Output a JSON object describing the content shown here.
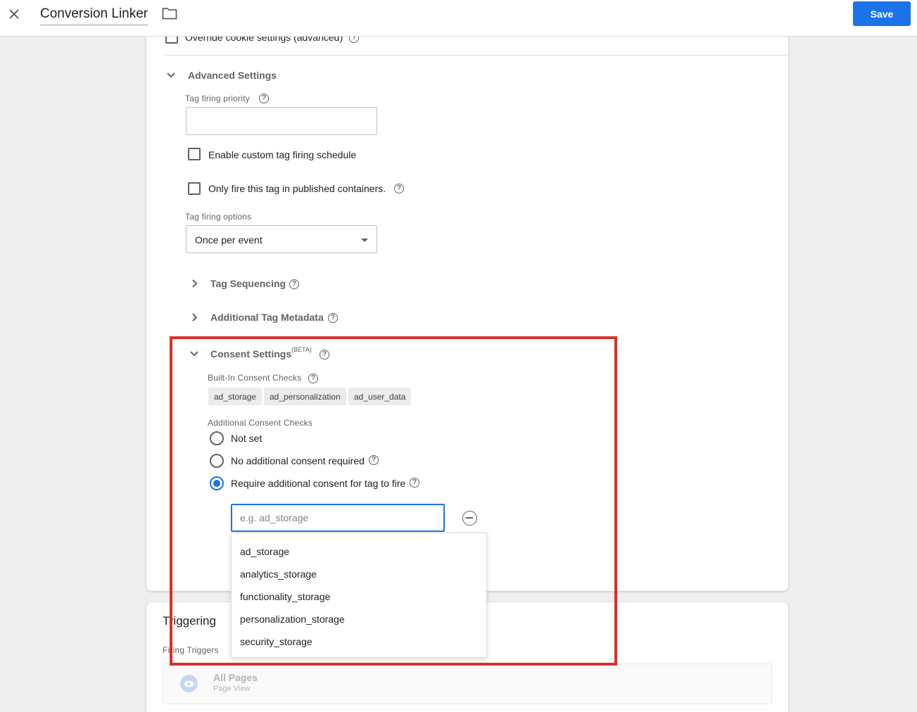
{
  "header": {
    "title": "Conversion Linker",
    "save_label": "Save"
  },
  "cookie": {
    "override_label": "Override cookie settings (advanced)"
  },
  "advanced": {
    "title": "Advanced Settings",
    "priority_label": "Tag firing priority",
    "priority_value": "",
    "custom_schedule_label": "Enable custom tag firing schedule",
    "published_only_label": "Only fire this tag in published containers.",
    "firing_options_label": "Tag firing options",
    "firing_options_value": "Once per event",
    "tag_sequencing": "Tag Sequencing",
    "additional_metadata": "Additional Tag Metadata"
  },
  "consent": {
    "title": "Consent Settings",
    "beta": "(BETA)",
    "builtin_label": "Built-In Consent Checks",
    "builtin_chips": [
      "ad_storage",
      "ad_personalization",
      "ad_user_data"
    ],
    "additional_label": "Additional Consent Checks",
    "options": [
      "Not set",
      "No additional consent required",
      "Require additional consent for tag to fire"
    ],
    "selected_option": "Require additional consent for tag to fire",
    "input_value": "",
    "input_placeholder": "e.g. ad_storage",
    "suggestions": [
      "ad_storage",
      "analytics_storage",
      "functionality_storage",
      "personalization_storage",
      "security_storage"
    ]
  },
  "triggering": {
    "title": "Triggering",
    "firing_triggers_label": "Firing Triggers",
    "trigger_name": "All Pages",
    "trigger_type": "Page View"
  },
  "colors": {
    "accent": "#1a73e8",
    "highlight": "#d93025"
  },
  "icons": [
    "close-icon",
    "folder-icon",
    "help-icon",
    "chevron-down-icon",
    "chevron-right-icon",
    "dropdown-arrow-icon",
    "remove-circle-icon",
    "eye-icon"
  ]
}
